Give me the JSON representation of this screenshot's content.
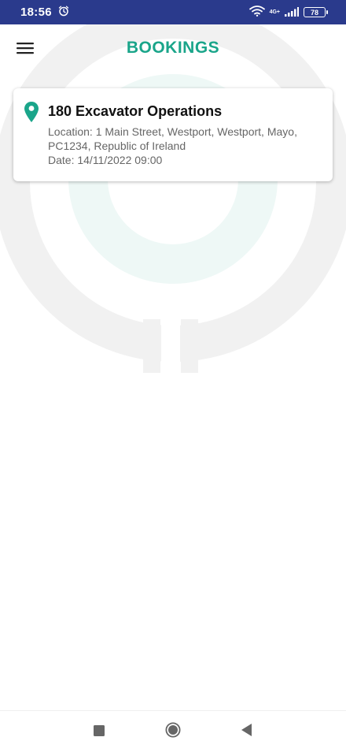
{
  "status_bar": {
    "time": "18:56",
    "network_type": "4G+",
    "battery_level": "78",
    "icons": [
      "alarm-icon",
      "wifi-icon",
      "signal-icon",
      "battery-icon"
    ]
  },
  "header": {
    "title": "BOOKINGS",
    "menu_icon": "hamburger-menu-icon"
  },
  "bookings": [
    {
      "title": "180 Excavator Operations",
      "location_line": "Location: 1 Main Street, Westport, Westport, Mayo, PC1234, Republic of Ireland",
      "date_line": "Date: 14/11/2022 09:00",
      "icon": "map-pin-icon"
    }
  ],
  "nav_bar": {
    "buttons": [
      "recent-apps-icon",
      "home-icon",
      "back-icon"
    ]
  },
  "colors": {
    "status_bar": "#2a3a8c",
    "accent": "#1aa58a",
    "card_title": "#111111",
    "card_text": "#666666"
  }
}
